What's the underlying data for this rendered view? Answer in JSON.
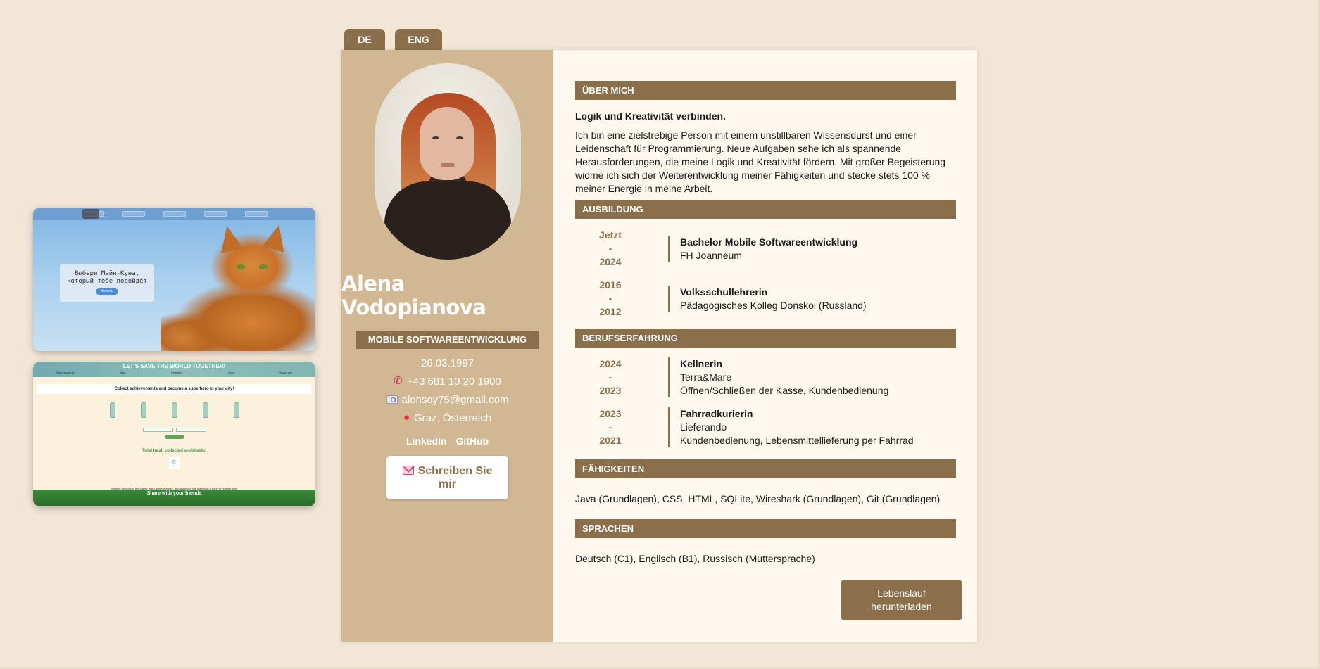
{
  "lang_tabs": {
    "de": "DE",
    "eng": "ENG"
  },
  "projects": {
    "cat": {
      "box_text": "Выбери Мейн-Куна, который тебе подойдёт",
      "button": "Начать"
    },
    "eco": {
      "title": "LET'S SAVE THE WORLD TOGETHER!",
      "nav": [
        "Start recycling",
        "Map",
        "Statistics",
        "Quiz",
        "About app"
      ],
      "banner": "Collect achievements and become a superhero in your city!",
      "total": "Total trash collected worldwide:",
      "zero": "0",
      "note": "Want to help clean the planet, earn achievements, and appear in the statistics? Log in or register now",
      "footer": "Share with your friends"
    }
  },
  "profile": {
    "name": "Alena Vodopianova",
    "role": "MOBILE SOFTWAREENTWICKLUNG",
    "birthdate": "26.03.1997",
    "phone": "+43 681 10 20 1900",
    "email": "alonsoy75@gmail.com",
    "location": "Graz, Österreich",
    "links": {
      "linkedin": "LinkedIn",
      "github": "GitHub"
    },
    "write_button": {
      "line1": "Schreiben Sie",
      "line2": "mir"
    },
    "icons": {
      "phone": "phone-icon",
      "email": "email-icon",
      "location": "location-pin-icon",
      "write": "envelope-icon"
    }
  },
  "sections": {
    "about": {
      "heading": "ÜBER MICH",
      "title": "Logik und Kreativität verbinden.",
      "text": "Ich bin eine zielstrebige Person mit einem unstillbaren Wissensdurst und einer Leidenschaft für Programmierung. Neue Aufgaben sehe ich als spannende Herausforderungen, die meine Logik und Kreativität fördern. Mit großer Begeisterung widme ich sich der Weiterentwicklung meiner Fähigkeiten und stecke stets 100 % meiner Energie in meine Arbeit."
    },
    "education": {
      "heading": "AUSBILDUNG",
      "entries": [
        {
          "from": "Jetzt",
          "sep": "-",
          "to": "2024",
          "title": "Bachelor Mobile Softwareentwicklung",
          "place": "FH Joanneum"
        },
        {
          "from": "2016",
          "sep": "-",
          "to": "2012",
          "title": "Volksschullehrerin",
          "place": "Pädagogisches Kolleg Donskoi (Russland)"
        }
      ]
    },
    "experience": {
      "heading": "BERUFSERFAHRUNG",
      "entries": [
        {
          "from": "2024",
          "sep": "-",
          "to": "2023",
          "title": "Kellnerin",
          "place": "Terra&Mare",
          "desc": "Öffnen/Schließen der Kasse, Kundenbedienung"
        },
        {
          "from": "2023",
          "sep": "-",
          "to": "2021",
          "title": "Fahrradkurierin",
          "place": "Lieferando",
          "desc": "Kundenbedienung, Lebensmittellieferung per Fahrrad"
        }
      ]
    },
    "skills": {
      "heading": "FÄHIGKEITEN",
      "text": "Java (Grundlagen), CSS, HTML, SQLite, Wireshark (Grundlagen), Git (Grundlagen)"
    },
    "languages": {
      "heading": "SPRACHEN",
      "text": "Deutsch (C1), Englisch (B1), Russisch (Muttersprache)"
    }
  },
  "cv_button": {
    "line1": "Lebenslauf",
    "line2": "herunterladen"
  },
  "colors": {
    "page_bg": "#f2e6d6",
    "accent": "#8b6f4a",
    "sidebar": "#d2b793",
    "main_bg": "#fff8ee"
  }
}
